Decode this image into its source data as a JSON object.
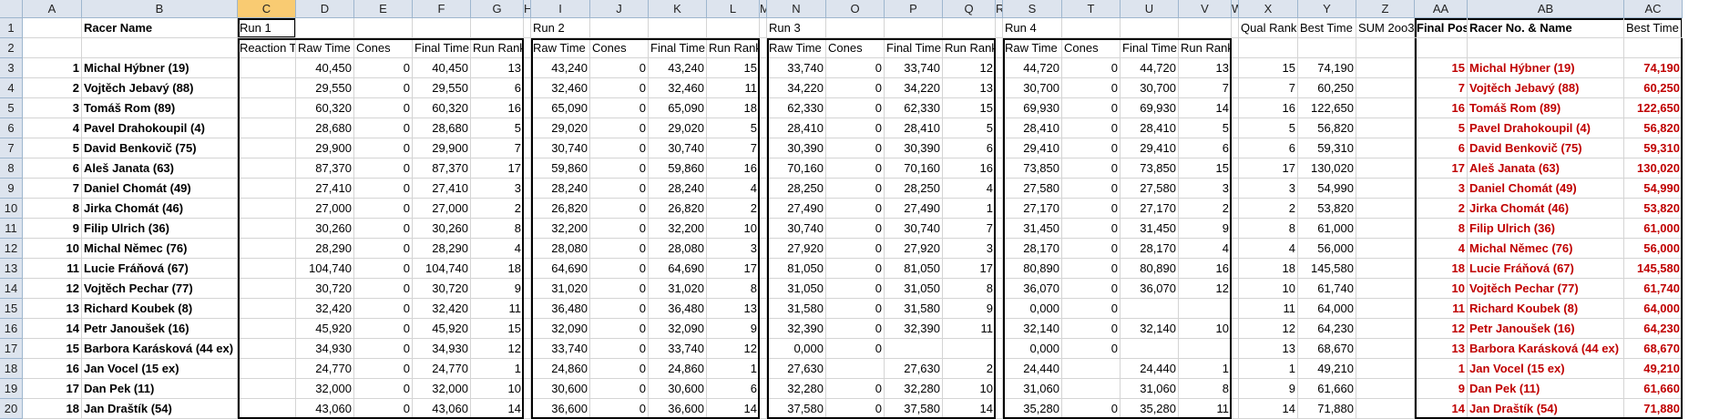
{
  "columns": [
    "A",
    "B",
    "C",
    "D",
    "E",
    "F",
    "G",
    "H",
    "I",
    "J",
    "K",
    "L",
    "M",
    "N",
    "O",
    "P",
    "Q",
    "R",
    "S",
    "T",
    "U",
    "V",
    "W",
    "X",
    "Y",
    "Z",
    "AA",
    "AB",
    "AC"
  ],
  "row1": {
    "racer_name": "Racer Name",
    "run1": "Run 1",
    "run2": "Run 2",
    "run3": "Run 3",
    "run4": "Run 4",
    "qual_rank": "Qual Rank",
    "best_time": "Best Time",
    "sum2of3": "SUM 2oo3",
    "final_position": "Final Position",
    "racer_no_name": "Racer No. & Name",
    "best_time2": "Best Time"
  },
  "row2": {
    "reaction": "Reaction Time",
    "raw": "Raw Time",
    "cones": "Cones",
    "final": "Final Time",
    "run_rank": "Run Rank"
  },
  "rows": [
    {
      "n": "1",
      "name": "Michal Hýbner (19)",
      "r1": [
        "40,450",
        "0",
        "40,450",
        "13"
      ],
      "r2": [
        "43,240",
        "0",
        "43,240",
        "15"
      ],
      "r3": [
        "33,740",
        "0",
        "33,740",
        "12"
      ],
      "r4": [
        "44,720",
        "0",
        "44,720",
        "13"
      ],
      "qual": "15",
      "best": "74,190",
      "fp": "15",
      "fname": "Michal Hýbner (19)",
      "fbest": "74,190"
    },
    {
      "n": "2",
      "name": "Vojtěch Jebavý (88)",
      "r1": [
        "29,550",
        "0",
        "29,550",
        "6"
      ],
      "r2": [
        "32,460",
        "0",
        "32,460",
        "11"
      ],
      "r3": [
        "34,220",
        "0",
        "34,220",
        "13"
      ],
      "r4": [
        "30,700",
        "0",
        "30,700",
        "7"
      ],
      "qual": "7",
      "best": "60,250",
      "fp": "7",
      "fname": "Vojtěch Jebavý (88)",
      "fbest": "60,250"
    },
    {
      "n": "3",
      "name": "Tomáš Rom (89)",
      "r1": [
        "60,320",
        "0",
        "60,320",
        "16"
      ],
      "r2": [
        "65,090",
        "0",
        "65,090",
        "18"
      ],
      "r3": [
        "62,330",
        "0",
        "62,330",
        "15"
      ],
      "r4": [
        "69,930",
        "0",
        "69,930",
        "14"
      ],
      "qual": "16",
      "best": "122,650",
      "fp": "16",
      "fname": "Tomáš Rom (89)",
      "fbest": "122,650"
    },
    {
      "n": "4",
      "name": "Pavel Drahokoupil (4)",
      "r1": [
        "28,680",
        "0",
        "28,680",
        "5"
      ],
      "r2": [
        "29,020",
        "0",
        "29,020",
        "5"
      ],
      "r3": [
        "28,410",
        "0",
        "28,410",
        "5"
      ],
      "r4": [
        "28,410",
        "0",
        "28,410",
        "5"
      ],
      "qual": "5",
      "best": "56,820",
      "fp": "5",
      "fname": "Pavel Drahokoupil (4)",
      "fbest": "56,820"
    },
    {
      "n": "5",
      "name": "David Benkovič (75)",
      "r1": [
        "29,900",
        "0",
        "29,900",
        "7"
      ],
      "r2": [
        "30,740",
        "0",
        "30,740",
        "7"
      ],
      "r3": [
        "30,390",
        "0",
        "30,390",
        "6"
      ],
      "r4": [
        "29,410",
        "0",
        "29,410",
        "6"
      ],
      "qual": "6",
      "best": "59,310",
      "fp": "6",
      "fname": "David Benkovič (75)",
      "fbest": "59,310"
    },
    {
      "n": "6",
      "name": "Aleš Janata (63)",
      "r1": [
        "87,370",
        "0",
        "87,370",
        "17"
      ],
      "r2": [
        "59,860",
        "0",
        "59,860",
        "16"
      ],
      "r3": [
        "70,160",
        "0",
        "70,160",
        "16"
      ],
      "r4": [
        "73,850",
        "0",
        "73,850",
        "15"
      ],
      "qual": "17",
      "best": "130,020",
      "fp": "17",
      "fname": "Aleš Janata (63)",
      "fbest": "130,020"
    },
    {
      "n": "7",
      "name": "Daniel Chomát (49)",
      "r1": [
        "27,410",
        "0",
        "27,410",
        "3"
      ],
      "r2": [
        "28,240",
        "0",
        "28,240",
        "4"
      ],
      "r3": [
        "28,250",
        "0",
        "28,250",
        "4"
      ],
      "r4": [
        "27,580",
        "0",
        "27,580",
        "3"
      ],
      "qual": "3",
      "best": "54,990",
      "fp": "3",
      "fname": "Daniel Chomát (49)",
      "fbest": "54,990"
    },
    {
      "n": "8",
      "name": "Jirka Chomát (46)",
      "r1": [
        "27,000",
        "0",
        "27,000",
        "2"
      ],
      "r2": [
        "26,820",
        "0",
        "26,820",
        "2"
      ],
      "r3": [
        "27,490",
        "0",
        "27,490",
        "1"
      ],
      "r4": [
        "27,170",
        "0",
        "27,170",
        "2"
      ],
      "qual": "2",
      "best": "53,820",
      "fp": "2",
      "fname": "Jirka Chomát (46)",
      "fbest": "53,820"
    },
    {
      "n": "9",
      "name": "Filip Ulrich (36)",
      "r1": [
        "30,260",
        "0",
        "30,260",
        "8"
      ],
      "r2": [
        "32,200",
        "0",
        "32,200",
        "10"
      ],
      "r3": [
        "30,740",
        "0",
        "30,740",
        "7"
      ],
      "r4": [
        "31,450",
        "0",
        "31,450",
        "9"
      ],
      "qual": "8",
      "best": "61,000",
      "fp": "8",
      "fname": "Filip Ulrich (36)",
      "fbest": "61,000"
    },
    {
      "n": "10",
      "name": "Michal Němec (76)",
      "r1": [
        "28,290",
        "0",
        "28,290",
        "4"
      ],
      "r2": [
        "28,080",
        "0",
        "28,080",
        "3"
      ],
      "r3": [
        "27,920",
        "0",
        "27,920",
        "3"
      ],
      "r4": [
        "28,170",
        "0",
        "28,170",
        "4"
      ],
      "qual": "4",
      "best": "56,000",
      "fp": "4",
      "fname": "Michal Němec (76)",
      "fbest": "56,000"
    },
    {
      "n": "11",
      "name": "Lucie Fráňová (67)",
      "r1": [
        "104,740",
        "0",
        "104,740",
        "18"
      ],
      "r2": [
        "64,690",
        "0",
        "64,690",
        "17"
      ],
      "r3": [
        "81,050",
        "0",
        "81,050",
        "17"
      ],
      "r4": [
        "80,890",
        "0",
        "80,890",
        "16"
      ],
      "qual": "18",
      "best": "145,580",
      "fp": "18",
      "fname": "Lucie Fráňová (67)",
      "fbest": "145,580"
    },
    {
      "n": "12",
      "name": "Vojtěch Pechar (77)",
      "r1": [
        "30,720",
        "0",
        "30,720",
        "9"
      ],
      "r2": [
        "31,020",
        "0",
        "31,020",
        "8"
      ],
      "r3": [
        "31,050",
        "0",
        "31,050",
        "8"
      ],
      "r4": [
        "36,070",
        "0",
        "36,070",
        "12"
      ],
      "qual": "10",
      "best": "61,740",
      "fp": "10",
      "fname": "Vojtěch Pechar (77)",
      "fbest": "61,740"
    },
    {
      "n": "13",
      "name": "Richard Koubek (8)",
      "r1": [
        "32,420",
        "0",
        "32,420",
        "11"
      ],
      "r2": [
        "36,480",
        "0",
        "36,480",
        "13"
      ],
      "r3": [
        "31,580",
        "0",
        "31,580",
        "9"
      ],
      "r4": [
        "0,000",
        "0",
        "",
        ""
      ],
      "qual": "11",
      "best": "64,000",
      "fp": "11",
      "fname": "Richard Koubek (8)",
      "fbest": "64,000"
    },
    {
      "n": "14",
      "name": "Petr Janoušek (16)",
      "r1": [
        "45,920",
        "0",
        "45,920",
        "15"
      ],
      "r2": [
        "32,090",
        "0",
        "32,090",
        "9"
      ],
      "r3": [
        "32,390",
        "0",
        "32,390",
        "11"
      ],
      "r4": [
        "32,140",
        "0",
        "32,140",
        "10"
      ],
      "qual": "12",
      "best": "64,230",
      "fp": "12",
      "fname": "Petr Janoušek (16)",
      "fbest": "64,230"
    },
    {
      "n": "15",
      "name": "Barbora Karásková (44 ex)",
      "r1": [
        "34,930",
        "0",
        "34,930",
        "12"
      ],
      "r2": [
        "33,740",
        "0",
        "33,740",
        "12"
      ],
      "r3": [
        "0,000",
        "0",
        "",
        ""
      ],
      "r4": [
        "0,000",
        "0",
        "",
        ""
      ],
      "qual": "13",
      "best": "68,670",
      "fp": "13",
      "fname": "Barbora Karásková (44 ex)",
      "fbest": "68,670"
    },
    {
      "n": "16",
      "name": "Jan Vocel (15 ex)",
      "r1": [
        "24,770",
        "0",
        "24,770",
        "1"
      ],
      "r2": [
        "24,860",
        "0",
        "24,860",
        "1"
      ],
      "r3": [
        "27,630",
        "",
        "27,630",
        "2"
      ],
      "r4": [
        "24,440",
        "",
        "24,440",
        "1"
      ],
      "qual": "1",
      "best": "49,210",
      "fp": "1",
      "fname": "Jan Vocel (15 ex)",
      "fbest": "49,210"
    },
    {
      "n": "17",
      "name": "Dan Pek (11)",
      "r1": [
        "32,000",
        "0",
        "32,000",
        "10"
      ],
      "r2": [
        "30,600",
        "0",
        "30,600",
        "6"
      ],
      "r3": [
        "32,280",
        "0",
        "32,280",
        "10"
      ],
      "r4": [
        "31,060",
        "",
        "31,060",
        "8"
      ],
      "qual": "9",
      "best": "61,660",
      "fp": "9",
      "fname": "Dan Pek (11)",
      "fbest": "61,660"
    },
    {
      "n": "18",
      "name": "Jan Draštík (54)",
      "r1": [
        "43,060",
        "0",
        "43,060",
        "14"
      ],
      "r2": [
        "36,600",
        "0",
        "36,600",
        "14"
      ],
      "r3": [
        "37,580",
        "0",
        "37,580",
        "14"
      ],
      "r4": [
        "35,280",
        "0",
        "35,280",
        "11"
      ],
      "qual": "14",
      "best": "71,880",
      "fp": "14",
      "fname": "Jan Draštík (54)",
      "fbest": "71,880"
    }
  ]
}
